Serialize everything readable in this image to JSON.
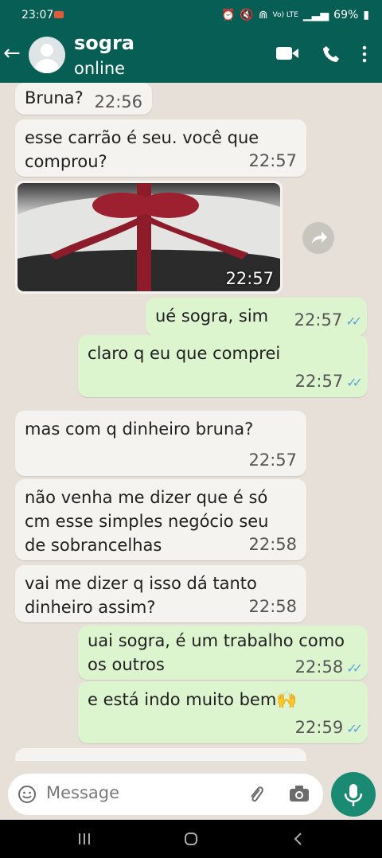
{
  "status_bar": {
    "time": "23:07",
    "battery": "69%",
    "network": "Vo) LTE"
  },
  "header": {
    "contact_name": "sogra",
    "contact_status": "online"
  },
  "messages": [
    {
      "dir": "in",
      "text": "Bruna?",
      "time": "22:56"
    },
    {
      "dir": "in",
      "text": "esse carrão é seu. você que\ncomprou?",
      "time": "22:57"
    },
    {
      "dir": "in",
      "type": "image",
      "time": "22:57"
    },
    {
      "dir": "out",
      "text": "ué sogra, sim",
      "time": "22:57"
    },
    {
      "dir": "out",
      "text": "claro q eu que comprei",
      "time": "22:57"
    },
    {
      "dir": "in",
      "text": "mas com q dinheiro bruna?",
      "time": "22:57"
    },
    {
      "dir": "in",
      "text": "não venha me dizer que é só\ncm esse simples negócio seu\nde sobrancelhas",
      "time": "22:58"
    },
    {
      "dir": "in",
      "text": "vai me dizer q isso dá tanto\ndinheiro assim?",
      "time": "22:58"
    },
    {
      "dir": "out",
      "text": "uai sogra, é um trabalho como\nos outros",
      "time": "22:58"
    },
    {
      "dir": "out",
      "text": "e está indo muito bem🙌",
      "time": "22:59"
    }
  ],
  "input": {
    "placeholder": "Message"
  },
  "icons": {
    "back": "arrow-left-icon",
    "video": "video-call-icon",
    "phone": "phone-icon",
    "menu": "more-vertical-icon",
    "emoji": "emoji-icon",
    "attach": "paperclip-icon",
    "camera": "camera-icon",
    "mic": "microphone-icon",
    "forward": "forward-icon"
  },
  "colors": {
    "header": "#075e54",
    "outgoing": "#dcf5cf",
    "incoming": "#f5f3f0",
    "read_check": "#5aa8d8",
    "mic_button": "#1a8a72"
  }
}
